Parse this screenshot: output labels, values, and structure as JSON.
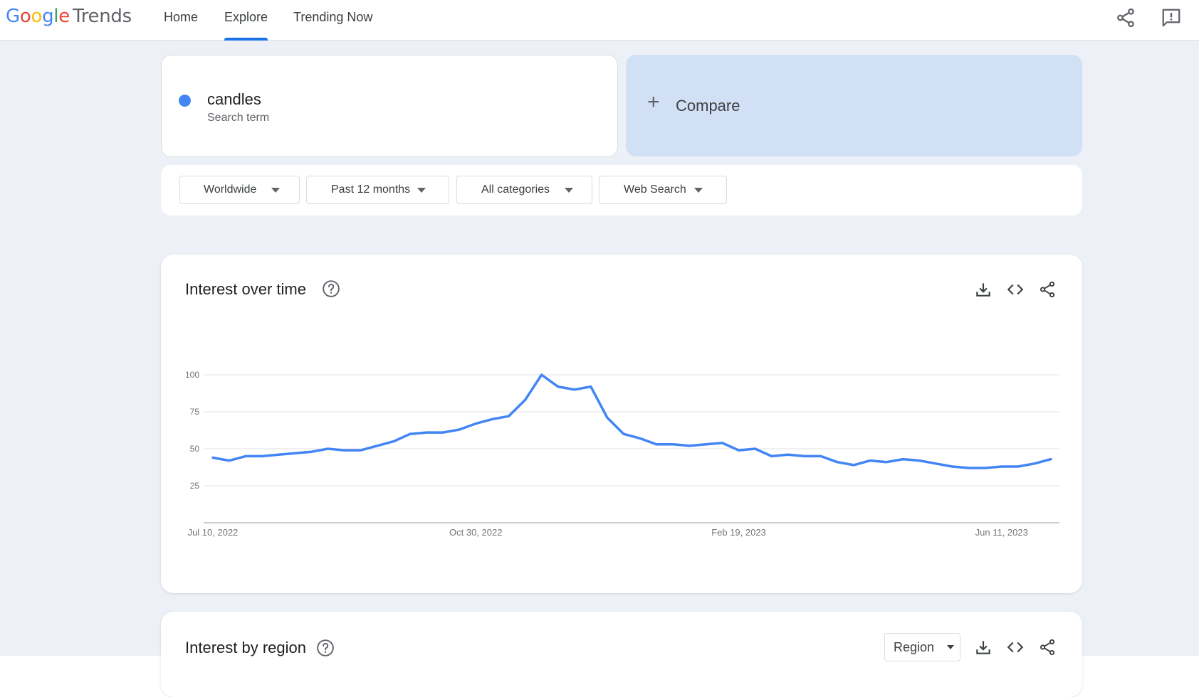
{
  "header": {
    "logo_letters": [
      "G",
      "o",
      "o",
      "g",
      "l",
      "e"
    ],
    "logo_product": "Trends",
    "tabs": [
      {
        "label": "Home",
        "active": false
      },
      {
        "label": "Explore",
        "active": true
      },
      {
        "label": "Trending Now",
        "active": false
      }
    ],
    "icons": [
      "share-icon",
      "feedback-icon"
    ]
  },
  "search_term": {
    "name": "candles",
    "type": "Search term",
    "color": "#4285f4"
  },
  "compare": {
    "label": "Compare",
    "icon": "plus-icon"
  },
  "filters": [
    {
      "label": "Worldwide"
    },
    {
      "label": "Past 12 months"
    },
    {
      "label": "All categories"
    },
    {
      "label": "Web Search"
    }
  ],
  "interest_over_time": {
    "title": "Interest over time",
    "icons": [
      "help-icon",
      "download-icon",
      "embed-icon",
      "share-icon"
    ]
  },
  "chart_data": {
    "type": "line",
    "title": "",
    "xlabel": "",
    "ylabel": "",
    "ylim": [
      0,
      100
    ],
    "yticks": [
      25,
      50,
      75,
      100
    ],
    "x_tick_labels": [
      "Jul 10, 2022",
      "Oct 30, 2022",
      "Feb 19, 2023",
      "Jun 11, 2023"
    ],
    "x_tick_indices": [
      0,
      16,
      32,
      48
    ],
    "grid": true,
    "series": [
      {
        "color": "#4285f4",
        "values": [
          44,
          42,
          45,
          45,
          46,
          47,
          48,
          50,
          49,
          49,
          52,
          55,
          60,
          61,
          61,
          63,
          67,
          70,
          72,
          83,
          100,
          92,
          90,
          92,
          71,
          60,
          57,
          53,
          53,
          52,
          53,
          54,
          49,
          50,
          45,
          46,
          45,
          45,
          41,
          39,
          42,
          41,
          43,
          42,
          40,
          38,
          37,
          37,
          38,
          38,
          40,
          43
        ]
      }
    ]
  },
  "interest_by_region": {
    "title": "Interest by region",
    "select_label": "Region",
    "icons": [
      "help-icon",
      "download-icon",
      "embed-icon",
      "share-icon"
    ]
  }
}
